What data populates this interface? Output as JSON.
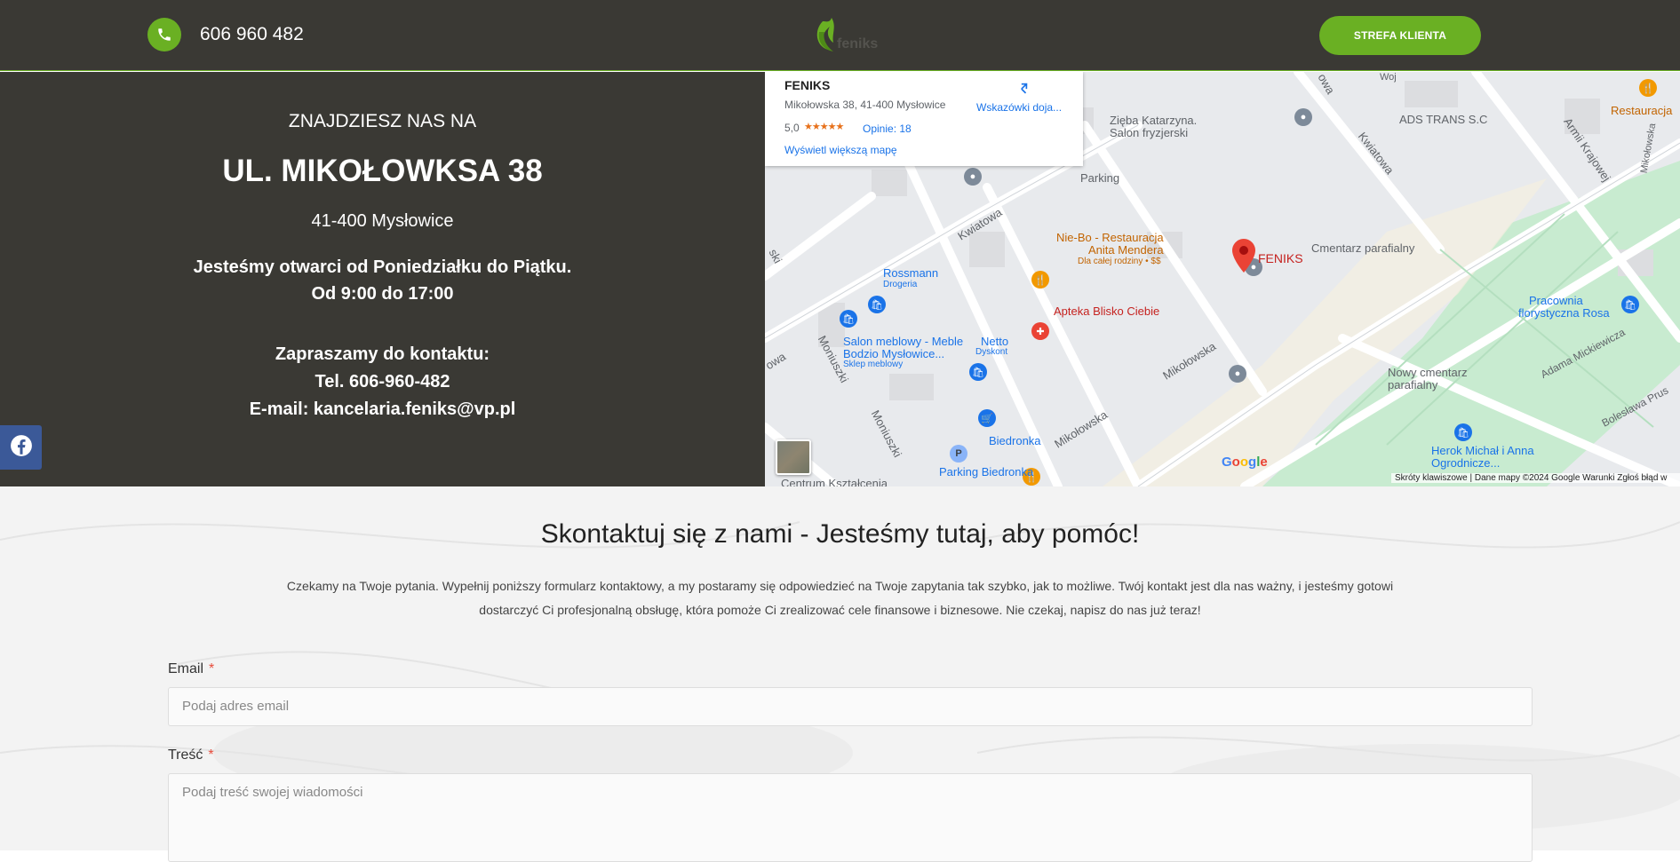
{
  "header": {
    "phone": "606 960 482",
    "logo_text": "feniks",
    "client_button": "STREFA KLIENTA"
  },
  "address": {
    "heading": "ZNAJDZIESZ NAS NA",
    "street": "UL. MIKOŁOWKSA 38",
    "city": "41-400 Mysłowice",
    "hours_line1": "Jesteśmy otwarci od Poniedziałku do Piątku.",
    "hours_line2": "Od 9:00 do 17:00",
    "contact_heading": "Zapraszamy do kontaktu:",
    "tel": "Tel. 606-960-482",
    "email": "E-mail: kancelaria.feniks@vp.pl"
  },
  "map": {
    "card": {
      "title": "FENIKS",
      "address": "Mikołowska 38, 41-400 Mysłowice",
      "rating": "5,0",
      "stars": "★★★★★",
      "reviews": "Opinie: 18",
      "bigger_map": "Wyświetl większą mapę",
      "directions": "Wskazówki doja..."
    },
    "labels": {
      "ziebakatarzyna": "Zięba Katarzyna.",
      "salon": "Salon fryzjerski",
      "ads": "ADS TRANS S.C",
      "restauracja": "Restauracja",
      "parking": "Parking",
      "kwiatowa1": "Kwiatowa",
      "kwiatowa2": "Kwiatowa",
      "wojska": "Woj",
      "armii": "Armii Krajowej",
      "mikolowska_v": "Mikołowska",
      "niebo1": "Nie-Bo - Restauracja",
      "niebo2": "Anita Mendera",
      "niebo3": "Dla całej rodziny • $$",
      "feniks": "FENIKS",
      "cmentarz": "Cmentarz parafialny",
      "rossmann": "Rossmann",
      "drogeria": "Drogeria",
      "apteka": "Apteka Blisko Ciebie",
      "pracownia1": "Pracownia",
      "pracownia2": "florystyczna Rosa",
      "salonmeb1": "Salon meblowy - Meble",
      "salonmeb2": "Bodzio Mysłowice...",
      "salonmeb3": "Sklep meblowy",
      "netto": "Netto",
      "dyskont": "Dyskont",
      "mikolowska1": "Mikołowska",
      "mikolowska2": "Mikołowska",
      "moniuszki1": "Moniuszki",
      "moniuszki2": "Moniuszki",
      "nowy1": "Nowy cmentarz",
      "nowy2": "parafialny",
      "adam": "Adama Mickiewicza",
      "boleslawa": "Bolesława Prus",
      "biedronka": "Biedronka",
      "parkingbied": "Parking Biedronka",
      "herokmichal1": "Herok Michał i Anna",
      "herokmichal2": "Ogrodnicze...",
      "centrum": "Centrum Kształcenia",
      "ski": "ski",
      "owa": "owa",
      "owa2": "owa"
    },
    "google": "Google",
    "attribution": "Skróty klawiszowe  |  Dane mapy ©2024 Google     Warunki     Zgłoś błąd w"
  },
  "contact": {
    "title": "Skontaktuj się z nami - Jesteśmy tutaj, aby pomóc!",
    "description": "Czekamy na Twoje pytania. Wypełnij poniższy formularz kontaktowy, a my postaramy się odpowiedzieć na Twoje zapytania tak szybko, jak to możliwe. Twój kontakt jest dla nas ważny, i jesteśmy gotowi dostarczyć Ci profesjonalną obsługę, która pomoże Ci zrealizować cele finansowe i biznesowe. Nie czekaj, napisz do nas już teraz!",
    "email_label": "Email",
    "email_placeholder": "Podaj adres email",
    "message_label": "Treść",
    "message_placeholder": "Podaj treść swojej wiadomości",
    "required_mark": "*"
  },
  "colors": {
    "header_bg": "#3a3934",
    "accent": "#6ab023",
    "facebook": "#3b5998"
  }
}
